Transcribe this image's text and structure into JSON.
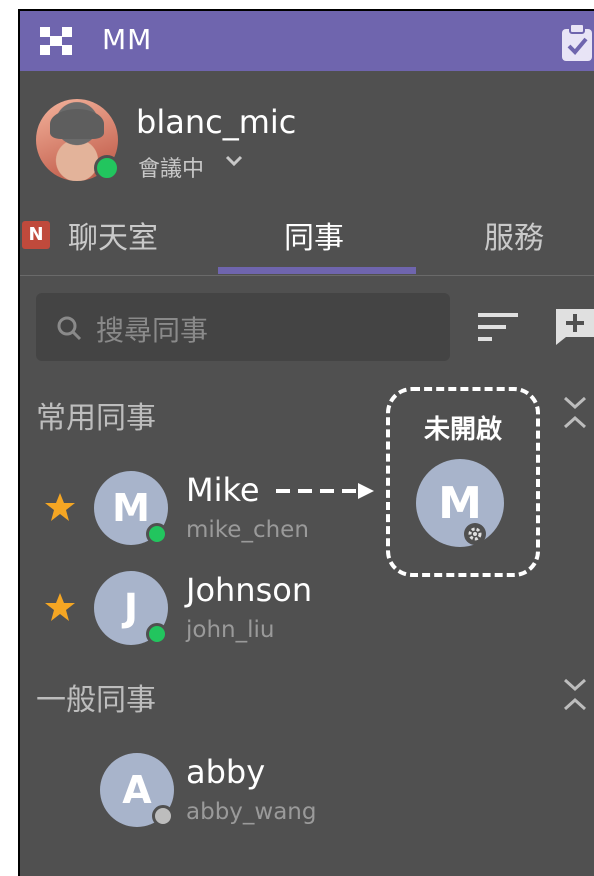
{
  "app": {
    "title": "MM"
  },
  "profile": {
    "username": "blanc_mic",
    "status": "會議中"
  },
  "tabs": [
    {
      "label": "聊天室",
      "badge": "N"
    },
    {
      "label": "同事"
    },
    {
      "label": "服務"
    }
  ],
  "search": {
    "placeholder": "搜尋同事"
  },
  "sections": {
    "favorites": {
      "label": "常用同事",
      "contacts": [
        {
          "name": "Mike",
          "username": "mike_chen",
          "initial": "M",
          "status": "online"
        },
        {
          "name": "Johnson",
          "username": "john_liu",
          "initial": "J",
          "status": "online"
        }
      ]
    },
    "general": {
      "label": "一般同事",
      "contacts": [
        {
          "name": "abby",
          "username": "abby_wang",
          "initial": "A",
          "status": "offline"
        }
      ]
    }
  },
  "annotation": {
    "label": "未開啟",
    "initial": "M"
  },
  "colors": {
    "accent": "#6f65ae",
    "background": "#505050",
    "online": "#22c55e",
    "star": "#f5a623",
    "avatar": "#a8b4cb"
  }
}
